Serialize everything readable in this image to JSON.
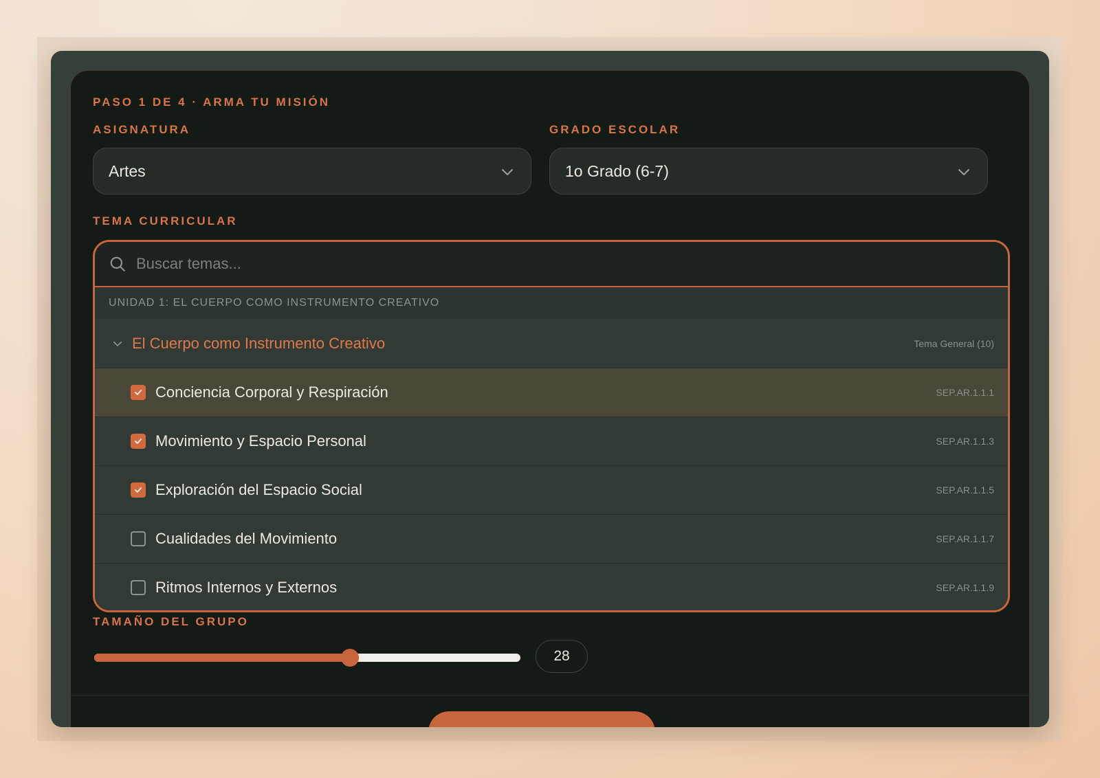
{
  "step_label": "PASO 1 DE 4 · ARMA TU MISIÓN",
  "subject": {
    "label": "ASIGNATURA",
    "value": "Artes"
  },
  "grade": {
    "label": "GRADO ESCOLAR",
    "value": "1o Grado (6-7)"
  },
  "topic": {
    "label": "TEMA CURRICULAR",
    "search_placeholder": "Buscar temas...",
    "unit_header": "UNIDAD 1: EL CUERPO COMO INSTRUMENTO CREATIVO",
    "group": {
      "title": "El Cuerpo como Instrumento Creativo",
      "meta": "Tema General (10)"
    },
    "items": [
      {
        "label": "Conciencia Corporal y Respiración",
        "code": "SEP.AR.1.1.1",
        "checked": true
      },
      {
        "label": "Movimiento y Espacio Personal",
        "code": "SEP.AR.1.1.3",
        "checked": true
      },
      {
        "label": "Exploración del Espacio Social",
        "code": "SEP.AR.1.1.5",
        "checked": true
      },
      {
        "label": "Cualidades del Movimiento",
        "code": "SEP.AR.1.1.7",
        "checked": false
      },
      {
        "label": "Ritmos Internos y Externos",
        "code": "SEP.AR.1.1.9",
        "checked": false
      }
    ]
  },
  "group_size": {
    "label": "TAMAÑO DEL GRUPO",
    "value": "28",
    "fraction": 0.6
  },
  "colors": {
    "accent": "#c7653c",
    "panel": "#141a16"
  }
}
